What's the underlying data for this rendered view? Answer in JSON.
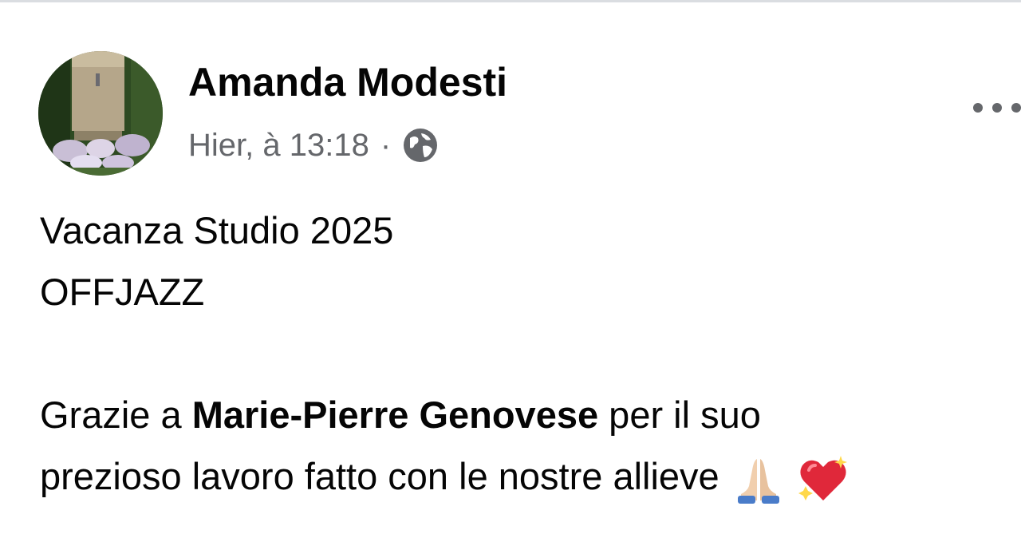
{
  "post": {
    "author": "Amanda Modesti",
    "timestamp": "Hier, à 13:18",
    "separator": "·",
    "audience_icon": "globe-icon",
    "more_icon": "more-options-icon",
    "lines": {
      "line1": "Vacanza Studio 2025",
      "line2": "OFFJAZZ",
      "line3_prefix": "Grazie a ",
      "line3_mention": "Marie-Pierre Genovese",
      "line3_suffix": " per il suo",
      "line4": "prezioso lavoro fatto con le nostre allieve"
    },
    "emojis": [
      "folded-hands-emoji",
      "sparkling-heart-emoji"
    ]
  },
  "colors": {
    "text_primary": "#050505",
    "text_secondary": "#65676b",
    "divider": "#dadde1"
  }
}
